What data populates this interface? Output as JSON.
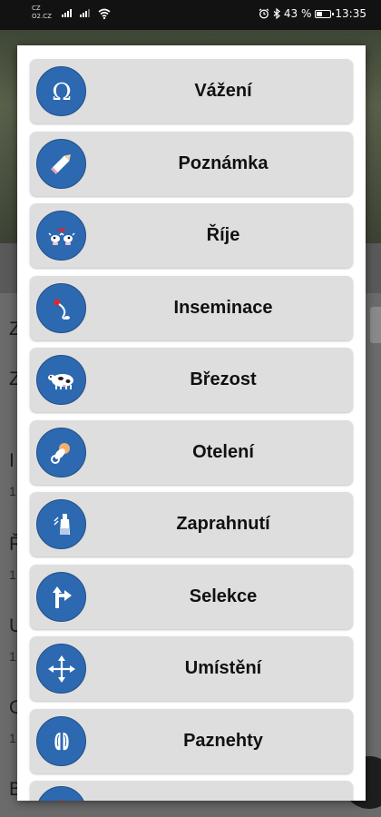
{
  "status_bar": {
    "carrier_1": "CZ",
    "carrier_2": "O2.CZ",
    "battery_text": "43 %",
    "battery_level": 0.43,
    "time": "13:35"
  },
  "background": {
    "letters": [
      "Z",
      "Z",
      "I",
      "Ř",
      "U",
      "O",
      "B"
    ],
    "subvalues": [
      "1",
      "1",
      "1",
      "1",
      "1"
    ]
  },
  "dialog": {
    "items": [
      {
        "label": "Vážení",
        "icon": "omega-icon"
      },
      {
        "label": "Poznámka",
        "icon": "pencil-icon"
      },
      {
        "label": "Říje",
        "icon": "cows-heat-icon"
      },
      {
        "label": "Inseminace",
        "icon": "insemination-icon"
      },
      {
        "label": "Březost",
        "icon": "pregnant-cow-icon"
      },
      {
        "label": "Otelení",
        "icon": "pacifier-icon"
      },
      {
        "label": "Zaprahnutí",
        "icon": "bottle-icon"
      },
      {
        "label": "Selekce",
        "icon": "road-fork-icon"
      },
      {
        "label": "Umístění",
        "icon": "move-arrows-icon"
      },
      {
        "label": "Paznehty",
        "icon": "hooves-icon"
      }
    ]
  },
  "colors": {
    "icon_circle": "#2c69b1",
    "item_background": "#dedede",
    "dialog_background": "#ffffff"
  }
}
